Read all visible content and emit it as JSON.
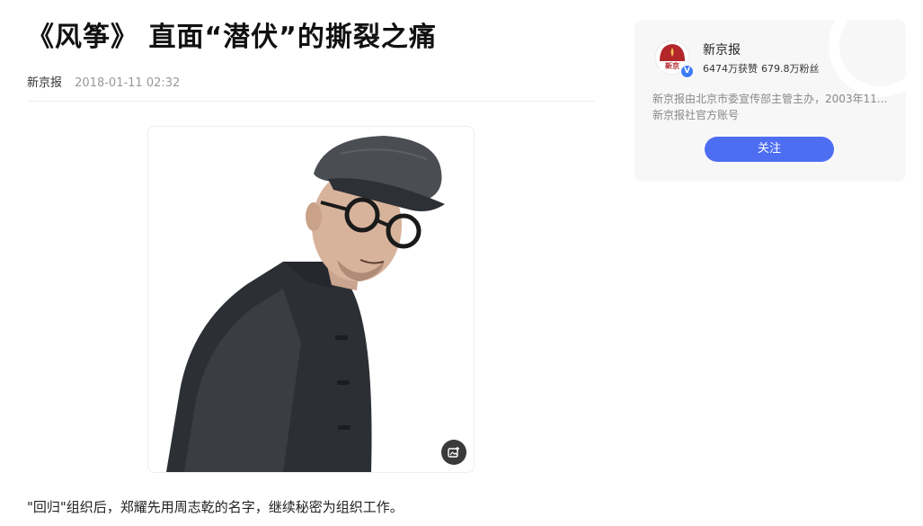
{
  "article": {
    "title": "《风筝》 直面“潜伏”的撕裂之痛",
    "source": "新京报",
    "time": "2018-01-11 02:32",
    "paragraph": "\"回归\"组织后，郑耀先用周志乾的名字，继续秘密为组织工作。",
    "image": {
      "subject": "man in flat cap, round glasses and dark jacket",
      "action_icon": "image-search-icon"
    }
  },
  "author": {
    "name": "新京报",
    "likes": "6474万获赞",
    "fans": "679.8万粉丝",
    "desc_line1": "新京报由北京市委宣传部主管主办，2003年11...",
    "desc_line2": "新京报社官方账号",
    "follow_label": "关注",
    "avatar_text": "新京",
    "verified_mark": "V"
  },
  "colors": {
    "accent": "#4e6ef2",
    "card_bg": "#f7f7f8",
    "avatar_red": "#b3262a",
    "verified": "#3e7bf6"
  }
}
